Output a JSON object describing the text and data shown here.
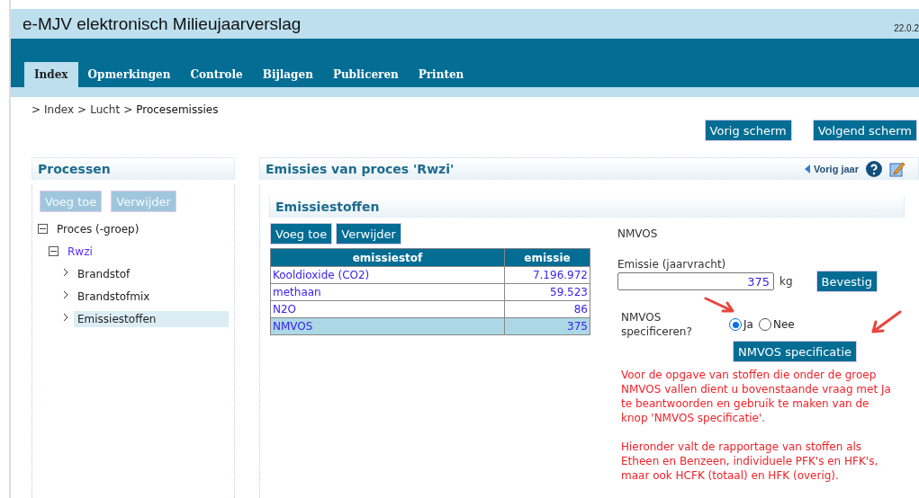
{
  "header": {
    "title": "e-MJV elektronisch Milieujaarverslag",
    "version": "22.0.2"
  },
  "tabs": [
    {
      "label": "Index",
      "selected": true
    },
    {
      "label": "Opmerkingen",
      "selected": false
    },
    {
      "label": "Controle",
      "selected": false
    },
    {
      "label": "Bijlagen",
      "selected": false
    },
    {
      "label": "Publiceren",
      "selected": false
    },
    {
      "label": "Printen",
      "selected": false
    }
  ],
  "breadcrumb": [
    {
      "prefix": ">",
      "label": "Index",
      "link": true
    },
    {
      "prefix": ">",
      "label": "Lucht",
      "link": true
    },
    {
      "prefix": ">",
      "label": "Procesemissies",
      "link": false
    }
  ],
  "nav_buttons": [
    "Vorig scherm",
    "Volgend scherm"
  ],
  "left_panel": {
    "title": "Processen",
    "buttons": [
      {
        "label": "Voeg toe",
        "disabled": true
      },
      {
        "label": "Verwijder",
        "disabled": true
      }
    ],
    "tree": [
      {
        "label": "Proces (-groep)",
        "expanded": true,
        "selected": false,
        "link": false,
        "children": [
          {
            "label": "Rwzi",
            "expanded": true,
            "selected": false,
            "link": true,
            "children": [
              {
                "label": "Brandstof",
                "selected": false
              },
              {
                "label": "Brandstofmix",
                "selected": false
              },
              {
                "label": "Emissiestoffen",
                "selected": true
              }
            ]
          }
        ]
      }
    ]
  },
  "main_panel": {
    "title": "Emissies van proces 'Rwzi'",
    "prev_year": "Vorig jaar",
    "section": {
      "title": "Emissiestoffen",
      "buttons": [
        {
          "label": "Voeg toe",
          "disabled": false
        },
        {
          "label": "Verwijder",
          "disabled": false
        }
      ],
      "table": {
        "columns": [
          "emissiestof",
          "emissie"
        ],
        "rows": [
          {
            "cells": [
              "Kooldioxide (CO2)",
              "7.196.972"
            ],
            "selected": false
          },
          {
            "cells": [
              "methaan",
              "59.523"
            ],
            "selected": false
          },
          {
            "cells": [
              "N2O",
              "86"
            ],
            "selected": false
          },
          {
            "cells": [
              "NMVOS",
              "375"
            ],
            "selected": true
          }
        ]
      }
    },
    "detail": {
      "name": "NMVOS",
      "field_label": "Emissie (jaarvracht)",
      "value": "375",
      "unit": "kg",
      "confirm": "Bevestig",
      "question": "NMVOS specificeren?",
      "options": [
        {
          "label": "Ja",
          "selected": true
        },
        {
          "label": "Nee",
          "selected": false
        }
      ],
      "spec_button": "NMVOS specificatie",
      "notes": [
        "Voor de opgave van stoffen die onder de groep NMVOS vallen dient u bovenstaande vraag met Ja te beantwoorden en gebruik te maken van de knop 'NMVOS specificatie'.",
        "Hieronder valt de rapportage van stoffen als Etheen en Benzeen, individuele PFK's en HFK's, maar ook HCFK (totaal) en HFK (overig)."
      ]
    }
  }
}
